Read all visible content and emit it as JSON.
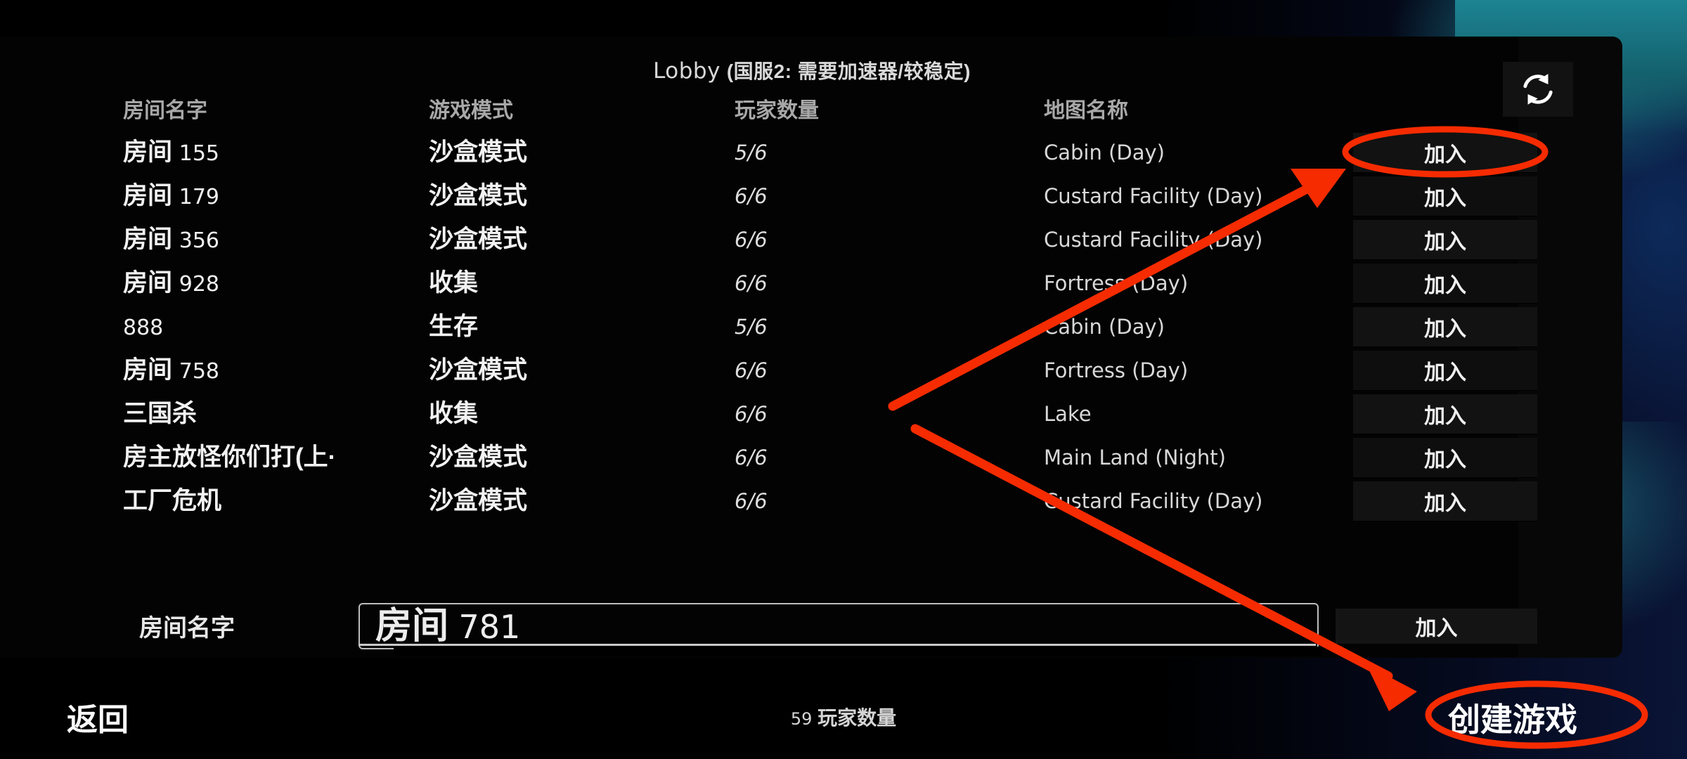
{
  "title": {
    "latin": "Lobby",
    "cjk": "(国服2: 需要加速器/较稳定)"
  },
  "columns": {
    "room_name": "房间名字",
    "game_mode": "游戏模式",
    "player_count": "玩家数量",
    "map_name": "地图名称"
  },
  "join_label": "加入",
  "rows": [
    {
      "name_prefix": "房间",
      "name_num": "155",
      "mode": "沙盒模式",
      "players": "5/6",
      "map": "Cabin (Day)",
      "join": "加入"
    },
    {
      "name_prefix": "房间",
      "name_num": "179",
      "mode": "沙盒模式",
      "players": "6/6",
      "map": "Custard Facility (Day)",
      "join": "加入"
    },
    {
      "name_prefix": "房间",
      "name_num": "356",
      "mode": "沙盒模式",
      "players": "6/6",
      "map": "Custard Facility (Day)",
      "join": "加入"
    },
    {
      "name_prefix": "房间",
      "name_num": "928",
      "mode": "收集",
      "players": "6/6",
      "map": "Fortress (Day)",
      "join": "加入"
    },
    {
      "name_prefix": "",
      "name_num": "888",
      "mode": "生存",
      "players": "5/6",
      "map": "Cabin (Day)",
      "join": "加入"
    },
    {
      "name_prefix": "房间",
      "name_num": "758",
      "mode": "沙盒模式",
      "players": "6/6",
      "map": "Fortress (Day)",
      "join": "加入"
    },
    {
      "name_prefix": "三国杀",
      "name_num": "",
      "mode": "收集",
      "players": "6/6",
      "map": "Lake",
      "join": "加入"
    },
    {
      "name_prefix": "房主放怪你们打(上·",
      "name_num": "",
      "mode": "沙盒模式",
      "players": "6/6",
      "map": "Main Land (Night)",
      "join": "加入"
    },
    {
      "name_prefix": "工厂危机",
      "name_num": "",
      "mode": "沙盒模式",
      "players": "6/6",
      "map": "Custard Facility (Day)",
      "join": "加入"
    }
  ],
  "form": {
    "label": "房间名字",
    "value_prefix": "房间",
    "value_num": "781",
    "placeholder": "房间名字",
    "join_label": "加入"
  },
  "footer": {
    "back_label": "返回",
    "player_total_num": "59",
    "player_total_label": "玩家数量",
    "create_label": "创建游戏"
  },
  "icons": {
    "refresh": "refresh-icon"
  },
  "colors": {
    "annotation": "#f62b00",
    "panel_bg": "#030303",
    "text_primary": "#f2f2f2",
    "text_secondary": "#a8a8a8",
    "button_bg": "#121212",
    "accent_teal": "#1d8492"
  }
}
